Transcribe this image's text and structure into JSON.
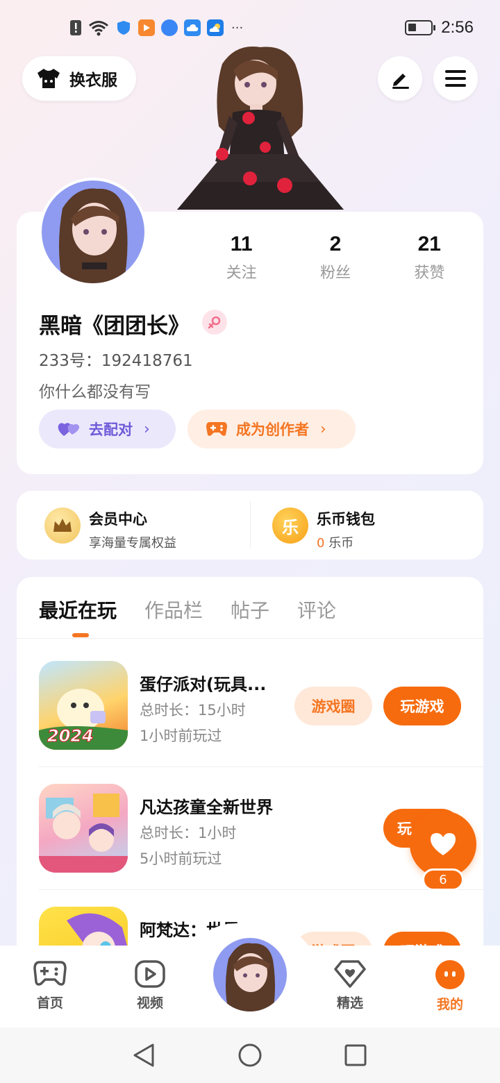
{
  "status_bar": {
    "time": "2:56",
    "more": "···",
    "icons": [
      "alert-icon",
      "wifi-icon",
      "shield-icon",
      "app-play-icon",
      "app-browser-icon",
      "cloud-icon",
      "weather-icon"
    ]
  },
  "header": {
    "outfit_label": "换衣服"
  },
  "profile": {
    "stats": [
      {
        "value": "11",
        "label": "关注"
      },
      {
        "value": "2",
        "label": "粉丝"
      },
      {
        "value": "21",
        "label": "获赞"
      }
    ],
    "nickname": "黑暗《团团长》",
    "uid": "233号：192418761",
    "bio": "你什么都没有写",
    "match_label": "去配对",
    "creator_label": "成为创作者"
  },
  "wallet": {
    "vip_title": "会员中心",
    "vip_sub": "享海量专属权益",
    "coin_title": "乐币钱包",
    "coin_amount": "0",
    "coin_unit": "乐币",
    "coin_glyph": "乐"
  },
  "tabs": [
    "最近在玩",
    "作品栏",
    "帖子",
    "评论"
  ],
  "games": [
    {
      "title": "蛋仔派对(玩具...",
      "duration": "总时长：15小时",
      "last_played": "1小时前玩过",
      "circle_label": "游戏圈",
      "play_label": "玩游戏",
      "badge": "2024"
    },
    {
      "title": "凡达孩童全新世界",
      "duration": "总时长：1小时",
      "last_played": "5小时前玩过",
      "circle_label": "",
      "play_label": "玩"
    },
    {
      "title": "阿梵达：世界",
      "duration": "",
      "last_played": "",
      "circle_label": "游戏圈",
      "play_label": "玩游戏"
    }
  ],
  "like_fab": {
    "count": "6"
  },
  "bottom_nav": [
    {
      "label": "首页",
      "icon": "gamepad-icon"
    },
    {
      "label": "视频",
      "icon": "video-icon"
    },
    {
      "label": "精选",
      "icon": "heart-diamond-icon"
    },
    {
      "label": "我的",
      "icon": "profile-face-icon"
    }
  ],
  "colors": {
    "accent": "#f66b0e",
    "purple": "#6f5ad8"
  }
}
